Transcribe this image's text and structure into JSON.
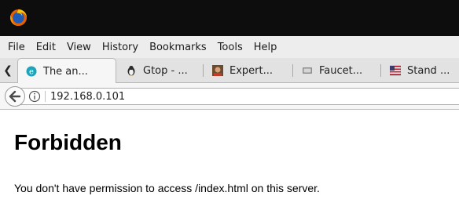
{
  "menu": [
    {
      "label": "File"
    },
    {
      "label": "Edit"
    },
    {
      "label": "View"
    },
    {
      "label": "History"
    },
    {
      "label": "Bookmarks"
    },
    {
      "label": "Tools"
    },
    {
      "label": "Help"
    }
  ],
  "tabs": [
    {
      "label": "The an...",
      "icon": "cloudflare-e-icon",
      "active": true
    },
    {
      "label": "Gtop - ...",
      "icon": "gtop-penguin-icon"
    },
    {
      "label": "Expert...",
      "icon": "expert-avatar-icon"
    },
    {
      "label": "Faucet...",
      "icon": "faucet-page-icon"
    },
    {
      "label": "Stand ...",
      "icon": "us-flag-icon"
    }
  ],
  "navigation": {
    "url": "192.168.0.101"
  },
  "page": {
    "heading": "Forbidden",
    "message": "You don't have permission to access /index.html on this server."
  },
  "colors": {
    "titlebar": "#0d0d0d",
    "menubar": "#ededed",
    "tabbar": "#e2e2e2",
    "active_tab": "#f6f6f6"
  }
}
